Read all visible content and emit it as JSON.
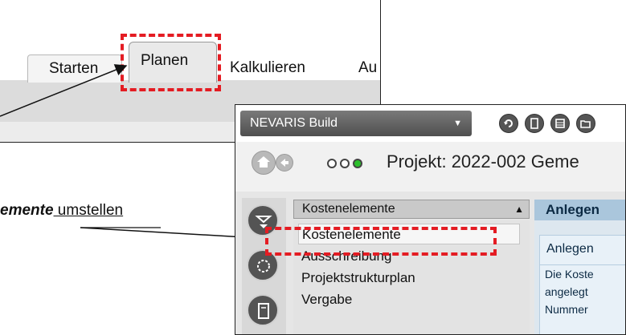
{
  "ribbon": {
    "tabs": [
      "Starten",
      "Planen",
      "Kalkulieren",
      "Au"
    ],
    "active_tab": "Planen"
  },
  "annotation": {
    "emphasis": "emente",
    "rest": " umstellen"
  },
  "app": {
    "title": "NEVARIS Build",
    "project_label": "Projekt: 2022-002 Geme",
    "list_header": "Kostenelemente",
    "list_items": [
      "Kostenelemente",
      "Ausschreibung",
      "Projektstrukturplan",
      "Vergabe"
    ],
    "selected_item": "Kostenelemente",
    "right_tab": "Anlegen",
    "panel_heading": "Anlegen",
    "panel_text": [
      "Die Koste",
      "angelegt",
      "Nummer"
    ]
  },
  "colors": {
    "highlight": "#e41c23",
    "status_dot_green": "#2bbf2b"
  },
  "icons": [
    "dropdown-caret-icon",
    "undo-icon",
    "document-icon",
    "list-icon",
    "folder-open-icon",
    "home-icon",
    "back-arrow-icon",
    "status-dot-icon",
    "cost-elements-icon",
    "tender-icon",
    "contract-icon",
    "sort-arrow-icon"
  ]
}
